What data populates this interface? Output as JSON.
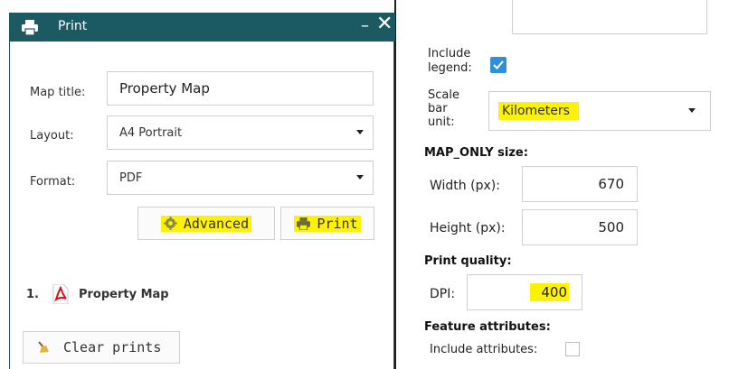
{
  "dialog": {
    "title": "Print",
    "minimize_glyph": "–",
    "close_glyph": "✕",
    "header_color": "#1b5a63",
    "fields": {
      "map_title_label": "Map title:",
      "map_title_value": "Property Map",
      "layout_label": "Layout:",
      "layout_value": "A4 Portrait",
      "format_label": "Format:",
      "format_value": "PDF"
    },
    "buttons": {
      "advanced_label": "Advanced",
      "print_label": "Print"
    },
    "results": [
      {
        "number": "1.",
        "icon": "pdf-icon",
        "title": "Property Map"
      }
    ],
    "clear_prints_label": "Clear prints",
    "highlight_color": "#fff200"
  },
  "advanced": {
    "include_legend_label": "Include legend:",
    "include_legend_checked": true,
    "scale_bar_unit_label": "Scale bar unit:",
    "scale_bar_unit_value": "Kilometers",
    "map_only_size_heading": "MAP_ONLY size:",
    "width_label": "Width (px):",
    "width_value": "670",
    "height_label": "Height (px):",
    "height_value": "500",
    "print_quality_heading": "Print quality:",
    "dpi_label": "DPI:",
    "dpi_value": "400",
    "feature_attributes_heading": "Feature attributes:",
    "include_attributes_label": "Include attributes:",
    "include_attributes_checked": false,
    "checkbox_color": "#2f8fd8"
  }
}
